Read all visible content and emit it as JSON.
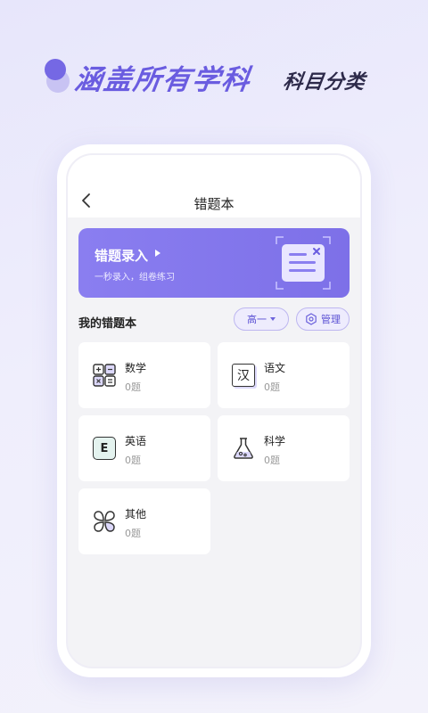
{
  "promo": {
    "title": "涵盖所有学科",
    "subtitle": "科目分类"
  },
  "header": {
    "title": "错题本"
  },
  "banner": {
    "title": "错题录入",
    "subtitle": "一秒录入，组卷练习"
  },
  "section": {
    "title": "我的错题本",
    "grade_selected": "高一",
    "manage_label": "管理"
  },
  "subjects": [
    {
      "name": "数学",
      "count": "0题",
      "icon": "math-grid-icon"
    },
    {
      "name": "语文",
      "count": "0题",
      "icon": "chinese-char-icon"
    },
    {
      "name": "英语",
      "count": "0题",
      "icon": "english-e-icon"
    },
    {
      "name": "科学",
      "count": "0题",
      "icon": "flask-icon"
    },
    {
      "name": "其他",
      "count": "0题",
      "icon": "clover-icon"
    }
  ],
  "subject_icon_glyphs": {
    "chinese": "汉",
    "english": "E"
  },
  "colors": {
    "accent": "#7568e4",
    "banner_bg": "#8a7ef0",
    "chip_bg": "#eeecfd",
    "page_bg": "#f3f3f6"
  }
}
